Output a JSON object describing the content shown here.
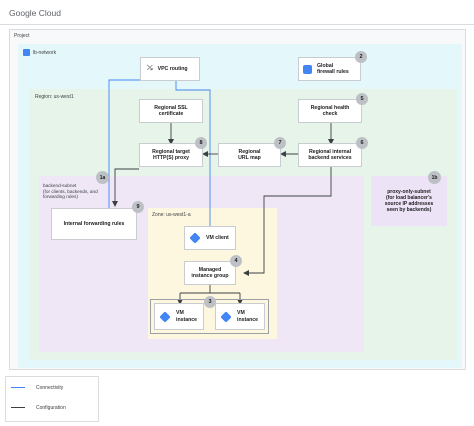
{
  "brand": "Google Cloud",
  "project_label": "Project",
  "network_label": "lb-network",
  "region_label": "Region: us-west1",
  "zone_label": "Zone: us-west1-a",
  "backend_subnet": "backend-subnet\n(for clients, backends, and\nforwarding rules)",
  "nodes": {
    "vpc_routing": "VPC routing",
    "firewall": "Global\nfirewall rules",
    "ssl_cert": "Regional SSL\ncertificate",
    "health_check": "Regional health\ncheck",
    "target_proxy": "Regional target\nHTTP(S) proxy",
    "url_map": "Regional\nURL map",
    "backend_services": "Regional internal\nbackend services",
    "forwarding_rules": "Internal forwarding rules",
    "vm_client": "VM client",
    "mig": "Managed\ninstance group",
    "vm1": "VM\ninstance",
    "vm2": "VM\ninstance",
    "proxy_subnet": "proxy-only-subnet\n(for load balancer's\nsource IP addresses\nseen by backends)"
  },
  "badges": {
    "firewall": "2",
    "health_check": "5",
    "backend_services": "6",
    "url_map": "7",
    "target_proxy": "8",
    "forwarding_rules": "9",
    "mig": "4",
    "vms": "3",
    "subnet_1a": "1a",
    "subnet_1b": "1b"
  },
  "legend": {
    "connectivity": "Connectivity",
    "configuration": "Configuration"
  },
  "colors": {
    "connectivity": "#4285f4",
    "configuration": "#3c4043",
    "network_bg": "#e4f7fb",
    "region_bg": "#e6f4ea",
    "subnet_bg": "#efe7f6",
    "zone_bg": "#fef7e0",
    "badge": "#bdc1c6"
  }
}
